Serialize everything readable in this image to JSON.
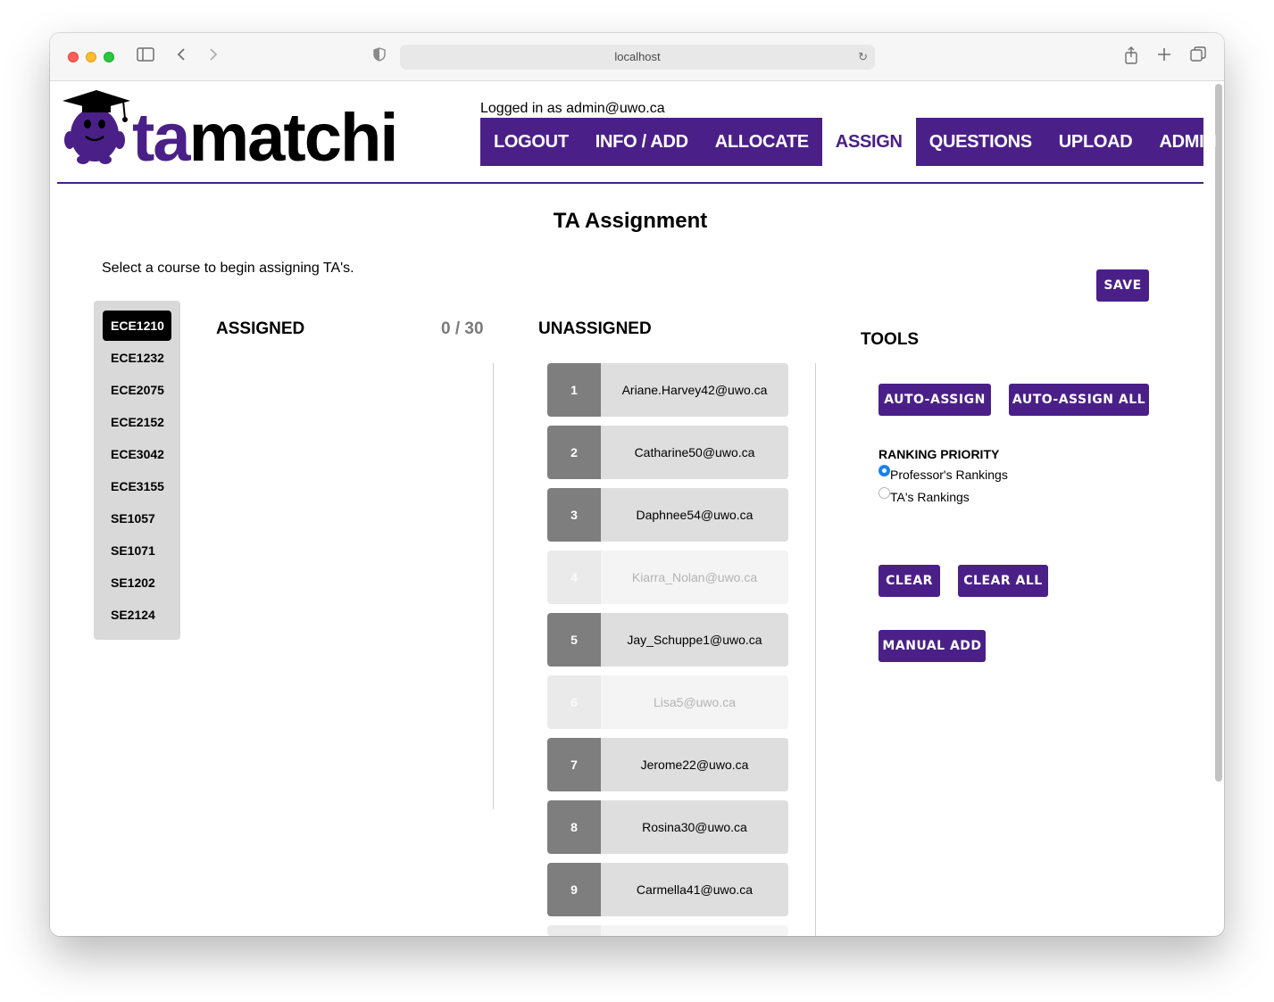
{
  "browser": {
    "url": "localhost"
  },
  "header": {
    "brand_prefix": "ta",
    "brand_suffix": "matchi",
    "logged_in": "Logged in as admin@uwo.ca",
    "nav": [
      {
        "label": "LOGOUT",
        "active": false
      },
      {
        "label": "INFO / ADD",
        "active": false
      },
      {
        "label": "ALLOCATE",
        "active": false
      },
      {
        "label": "ASSIGN",
        "active": true
      },
      {
        "label": "QUESTIONS",
        "active": false
      },
      {
        "label": "UPLOAD",
        "active": false
      },
      {
        "label": "ADMIN",
        "active": false
      }
    ]
  },
  "main": {
    "title": "TA Assignment",
    "instruction": "Select a course to begin assigning TA's.",
    "save_label": "SAVE",
    "courses": [
      "ECE1210",
      "ECE1232",
      "ECE2075",
      "ECE2152",
      "ECE3042",
      "ECE3155",
      "SE1057",
      "SE1071",
      "SE1202",
      "SE2124"
    ],
    "selected_course": "ECE1210",
    "assigned_heading": "ASSIGNED",
    "assigned_count": "0 / 30",
    "unassigned_heading": "UNASSIGNED",
    "unassigned": [
      {
        "rank": "1",
        "email": "Ariane.Harvey42@uwo.ca",
        "faded": false
      },
      {
        "rank": "2",
        "email": "Catharine50@uwo.ca",
        "faded": false
      },
      {
        "rank": "3",
        "email": "Daphnee54@uwo.ca",
        "faded": false
      },
      {
        "rank": "4",
        "email": "Kiarra_Nolan@uwo.ca",
        "faded": true
      },
      {
        "rank": "5",
        "email": "Jay_Schuppe1@uwo.ca",
        "faded": false
      },
      {
        "rank": "6",
        "email": "Lisa5@uwo.ca",
        "faded": true
      },
      {
        "rank": "7",
        "email": "Jerome22@uwo.ca",
        "faded": false
      },
      {
        "rank": "8",
        "email": "Rosina30@uwo.ca",
        "faded": false
      },
      {
        "rank": "9",
        "email": "Carmella41@uwo.ca",
        "faded": false
      }
    ]
  },
  "tools": {
    "heading": "TOOLS",
    "auto_assign": "AUTO-ASSIGN",
    "auto_assign_all": "AUTO-ASSIGN ALL",
    "ranking_label": "RANKING PRIORITY",
    "ranking_options": [
      {
        "label": "Professor's Rankings",
        "checked": true
      },
      {
        "label": "TA's Rankings",
        "checked": false
      }
    ],
    "clear": "CLEAR",
    "clear_all": "CLEAR ALL",
    "manual_add": "MANUAL ADD"
  },
  "colors": {
    "brand_purple": "#4a2088",
    "rank_gray": "#7e7e7e",
    "row_gray": "#dedede"
  }
}
